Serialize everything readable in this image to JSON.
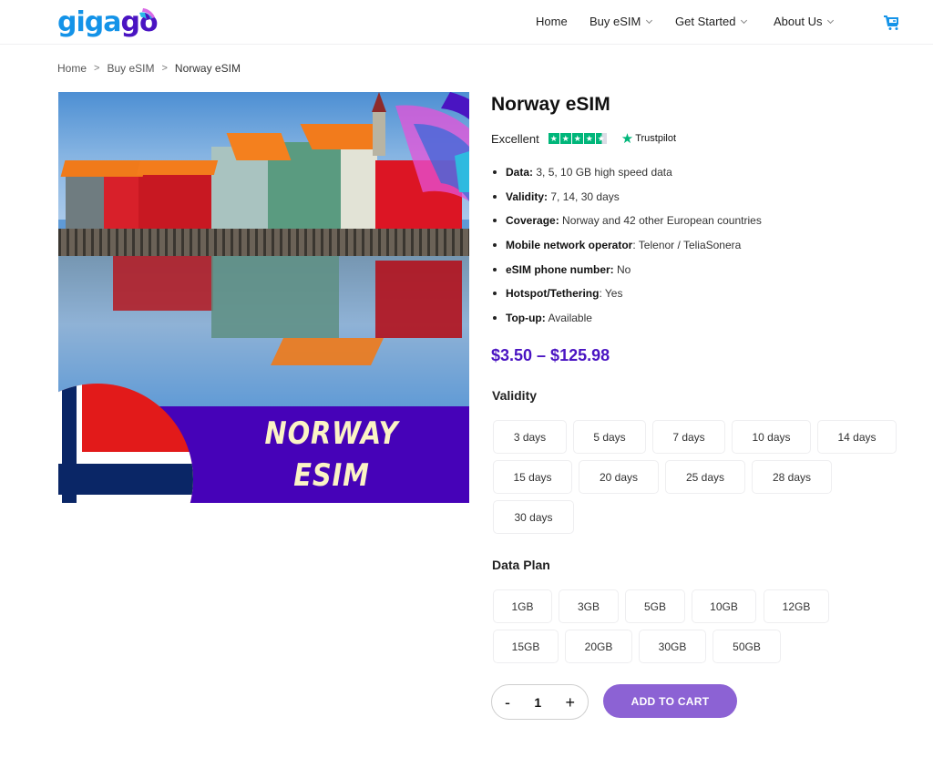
{
  "header": {
    "logo": {
      "part1": "giga",
      "part2": "go"
    },
    "nav": [
      {
        "label": "Home",
        "has_dropdown": false
      },
      {
        "label": "Buy eSIM",
        "has_dropdown": true
      },
      {
        "label": "Get Started",
        "has_dropdown": true
      },
      {
        "label": "About Us",
        "has_dropdown": true
      }
    ],
    "cart_icon": "shopping-cart-icon"
  },
  "breadcrumb": {
    "items": [
      "Home",
      "Buy eSIM",
      "Norway eSIM"
    ],
    "separator": ">"
  },
  "product_image": {
    "banner_line1": "NORWAY",
    "banner_line2": "ESIM"
  },
  "product": {
    "title": "Norway eSIM",
    "rating_label": "Excellent",
    "rating_stars": 4.5,
    "rating_source": "Trustpilot",
    "features": [
      {
        "label": "Data:",
        "value": " 3, 5, 10 GB high speed data"
      },
      {
        "label": "Validity:",
        "value": " 7, 14, 30 days"
      },
      {
        "label": "Coverage:",
        "value": " Norway and 42 other European countries"
      },
      {
        "label": "Mobile network operator",
        "value": ": Telenor / TeliaSonera"
      },
      {
        "label": "eSIM phone number:",
        "value": " No"
      },
      {
        "label": "Hotspot/Tethering",
        "value": ": Yes"
      },
      {
        "label": "Top-up:",
        "value": " Available"
      }
    ],
    "price": "$3.50 – $125.98"
  },
  "validity": {
    "label": "Validity",
    "options": [
      "3 days",
      "5 days",
      "7 days",
      "10 days",
      "14 days",
      "15 days",
      "20 days",
      "25 days",
      "28 days",
      "30 days"
    ]
  },
  "data_plan": {
    "label": "Data Plan",
    "options": [
      "1GB",
      "3GB",
      "5GB",
      "10GB",
      "12GB",
      "15GB",
      "20GB",
      "30GB",
      "50GB"
    ]
  },
  "purchase": {
    "minus": "-",
    "quantity": "1",
    "plus": "+",
    "add_to_cart": "ADD TO CART"
  },
  "colors": {
    "brand_blue": "#1493e8",
    "brand_purple": "#4a14c2",
    "button_purple": "#8c62d4",
    "trustpilot_green": "#00b67a"
  }
}
